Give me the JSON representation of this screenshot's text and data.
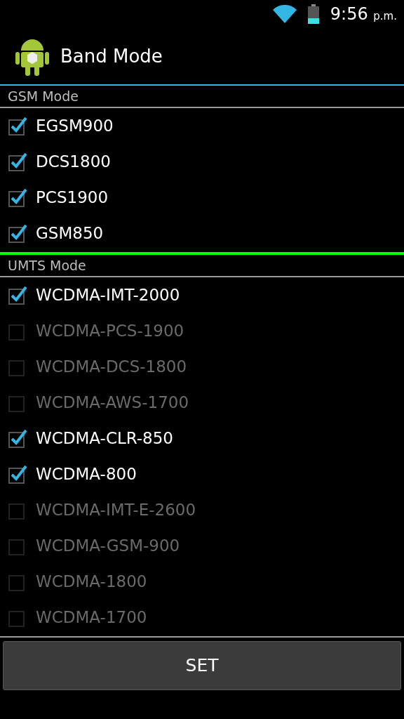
{
  "status_bar": {
    "time": "9:56",
    "period": "p.m."
  },
  "action_bar": {
    "title": "Band Mode"
  },
  "sections": [
    {
      "title": "GSM Mode",
      "items": [
        {
          "label": "EGSM900",
          "checked": true,
          "disabled": false
        },
        {
          "label": "DCS1800",
          "checked": true,
          "disabled": false
        },
        {
          "label": "PCS1900",
          "checked": true,
          "disabled": false
        },
        {
          "label": "GSM850",
          "checked": true,
          "disabled": false
        }
      ]
    },
    {
      "title": "UMTS Mode",
      "items": [
        {
          "label": "WCDMA-IMT-2000",
          "checked": true,
          "disabled": false
        },
        {
          "label": "WCDMA-PCS-1900",
          "checked": false,
          "disabled": true
        },
        {
          "label": "WCDMA-DCS-1800",
          "checked": false,
          "disabled": true
        },
        {
          "label": "WCDMA-AWS-1700",
          "checked": false,
          "disabled": true
        },
        {
          "label": "WCDMA-CLR-850",
          "checked": true,
          "disabled": false
        },
        {
          "label": "WCDMA-800",
          "checked": true,
          "disabled": false
        },
        {
          "label": "WCDMA-IMT-E-2600",
          "checked": false,
          "disabled": true
        },
        {
          "label": "WCDMA-GSM-900",
          "checked": false,
          "disabled": true
        },
        {
          "label": "WCDMA-1800",
          "checked": false,
          "disabled": true
        },
        {
          "label": "WCDMA-1700",
          "checked": false,
          "disabled": true
        }
      ]
    }
  ],
  "button": {
    "label": "SET"
  }
}
